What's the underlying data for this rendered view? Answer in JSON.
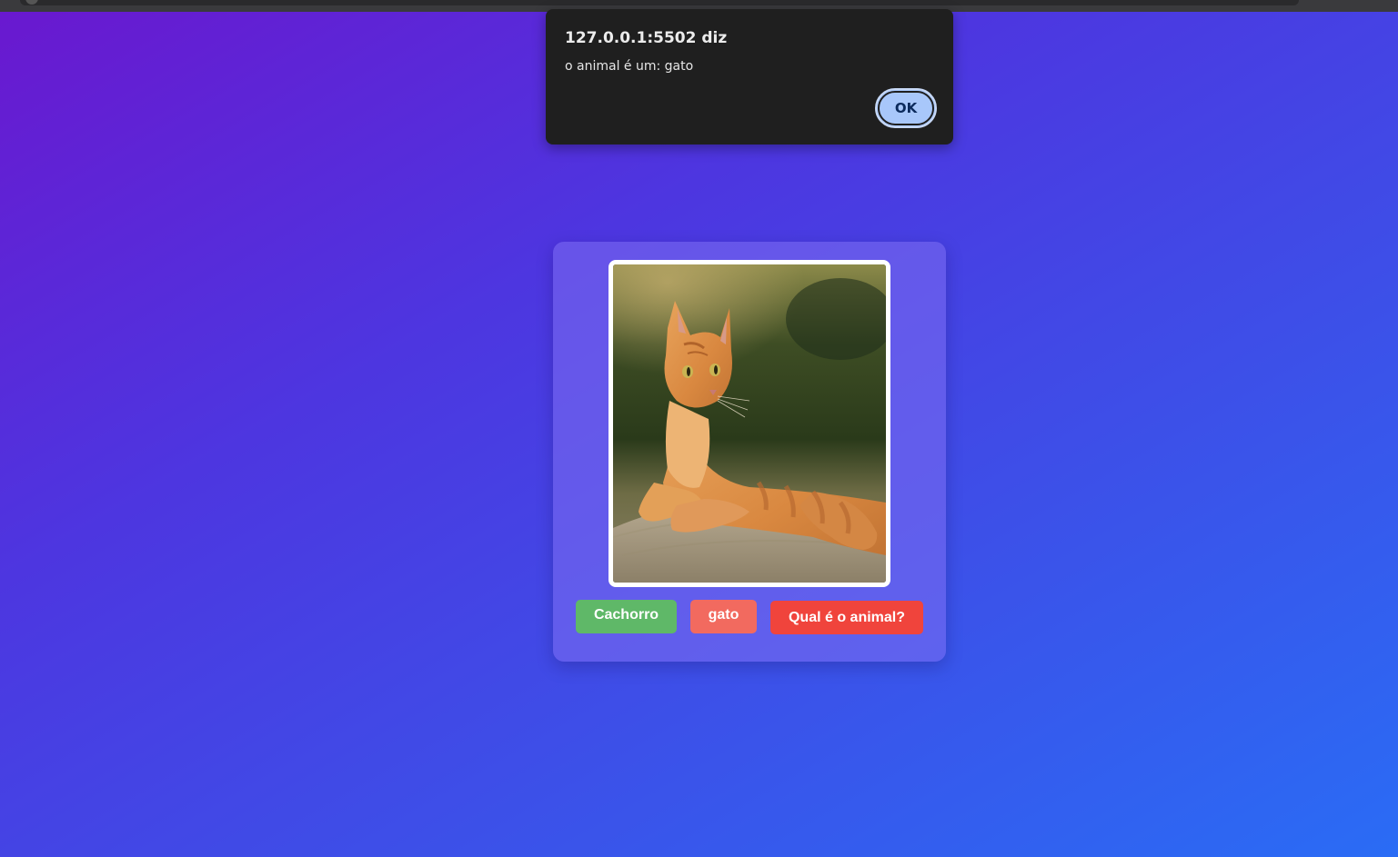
{
  "alert": {
    "title": "127.0.0.1:5502 diz",
    "message": "o animal é um: gato",
    "ok_label": "OK"
  },
  "card": {
    "image_subject": "orange tabby cat lying down",
    "buttons": {
      "dog_label": "Cachorro",
      "cat_label": "gato",
      "which_label": "Qual é o animal?"
    }
  },
  "colors": {
    "background_start": "#6a18cf",
    "background_end": "#2a6cf5",
    "dog_button": "#5fb868",
    "cat_button": "#f26a5f",
    "which_button": "#f0443c",
    "alert_bg": "#1f1f1f",
    "ok_button": "#a8c7fa"
  }
}
